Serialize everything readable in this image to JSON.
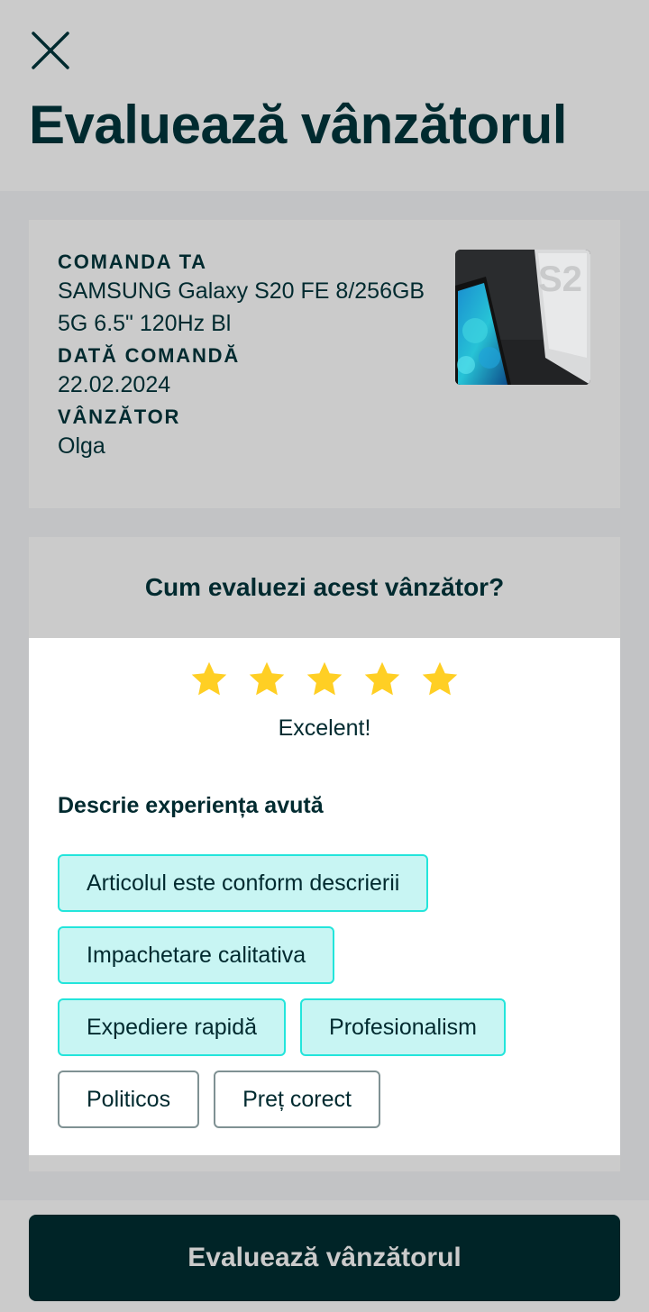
{
  "header": {
    "title": "Evaluează vânzătorul",
    "close_icon": "close-icon"
  },
  "order": {
    "order_label": "Comanda ta",
    "product_name": "SAMSUNG Galaxy S20 FE 8/256GB 5G 6.5\" 120Hz Bl",
    "date_label": "Dată comandă",
    "date_value": "22.02.2024",
    "seller_label": "Vânzător",
    "seller_value": "Olga",
    "thumbnail_icon": "product-photo"
  },
  "rating": {
    "question": "Cum evaluezi acest vânzător?",
    "stars": 5,
    "max_stars": 5,
    "star_icon": "star-icon",
    "star_color": "#ffcf24",
    "rating_text": "Excelent!",
    "describe_title": "Descrie experiența avută",
    "chips": [
      {
        "label": "Articolul este conform descrierii",
        "selected": true
      },
      {
        "label": "Impachetare calitativa",
        "selected": true
      },
      {
        "label": "Expediere rapidă",
        "selected": true
      },
      {
        "label": "Profesionalism",
        "selected": true
      },
      {
        "label": "Politicos",
        "selected": false
      },
      {
        "label": "Preț corect",
        "selected": false
      }
    ]
  },
  "footer": {
    "submit_label": "Evaluează vânzătorul"
  },
  "colors": {
    "primary_dark": "#002a2f",
    "chip_selected_bg": "#c8f5f3",
    "chip_selected_border": "#23e5db",
    "chip_unselected_border": "#7f9193"
  }
}
